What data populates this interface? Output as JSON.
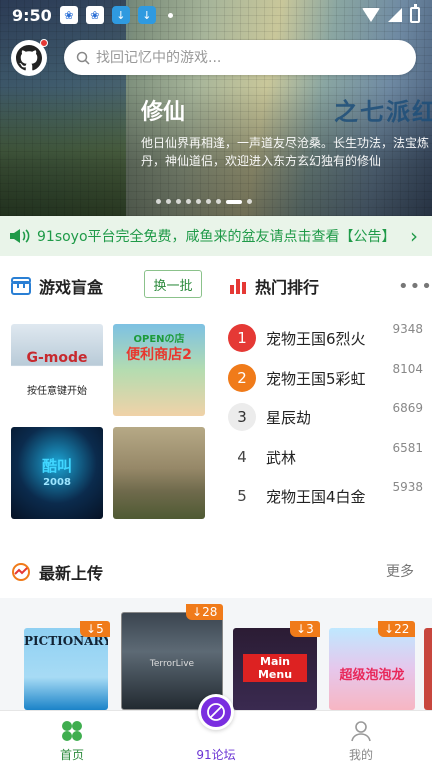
{
  "status_bar": {
    "time": "9:50"
  },
  "search": {
    "placeholder": "找回记忆中的游戏..."
  },
  "banner": {
    "title": "修仙",
    "description": "他日仙界再相逢，一声道友尽沧桑。长生功法，法宝炼丹，神仙道侣，欢迎进入东方玄幻独有的修仙",
    "deco_title": "之七派红",
    "slide_count": 9,
    "active_slide": 7
  },
  "notice": {
    "text": "91soyo平台完全免费，咸鱼来的盆友请点击查看【公告】"
  },
  "blind_box": {
    "title": "游戏盲盒",
    "swap_label": "换一批",
    "tiles": [
      {
        "caption_top": "G-mode",
        "caption_bottom": "按任意键开始"
      },
      {
        "caption_top": "OPENの店",
        "caption_bottom": "便利商店2"
      },
      {
        "caption_top": "酷叫",
        "caption_bottom": "2008"
      },
      {
        "caption_top": "",
        "caption_bottom": ""
      }
    ]
  },
  "hot_rank": {
    "title": "热门排行",
    "items": [
      {
        "rank": "1",
        "name": "宠物王国6烈火",
        "count": "9348"
      },
      {
        "rank": "2",
        "name": "宠物王国5彩虹",
        "count": "8104"
      },
      {
        "rank": "3",
        "name": "星辰劫",
        "count": "6869"
      },
      {
        "rank": "4",
        "name": "武林",
        "count": "6581"
      },
      {
        "rank": "5",
        "name": "宠物王国4白金",
        "count": "5938"
      }
    ]
  },
  "latest": {
    "title": "最新上传",
    "more_label": "更多",
    "covers": [
      {
        "title": "PICTIONARY",
        "downloads": "5"
      },
      {
        "title": "TerrorLive",
        "downloads": "28"
      },
      {
        "title": "Main Menu",
        "downloads": "3"
      },
      {
        "title": "超级泡泡龙",
        "downloads": "22"
      }
    ]
  },
  "bottom_nav": {
    "home": "首页",
    "forum": "91论坛",
    "me": "我的"
  },
  "colors": {
    "accent_green": "#2e8b3e",
    "notice_green": "#1f9a48",
    "forum_purple": "#7a2ee0",
    "badge_orange": "#f07b1a",
    "rank_red": "#e53935"
  }
}
